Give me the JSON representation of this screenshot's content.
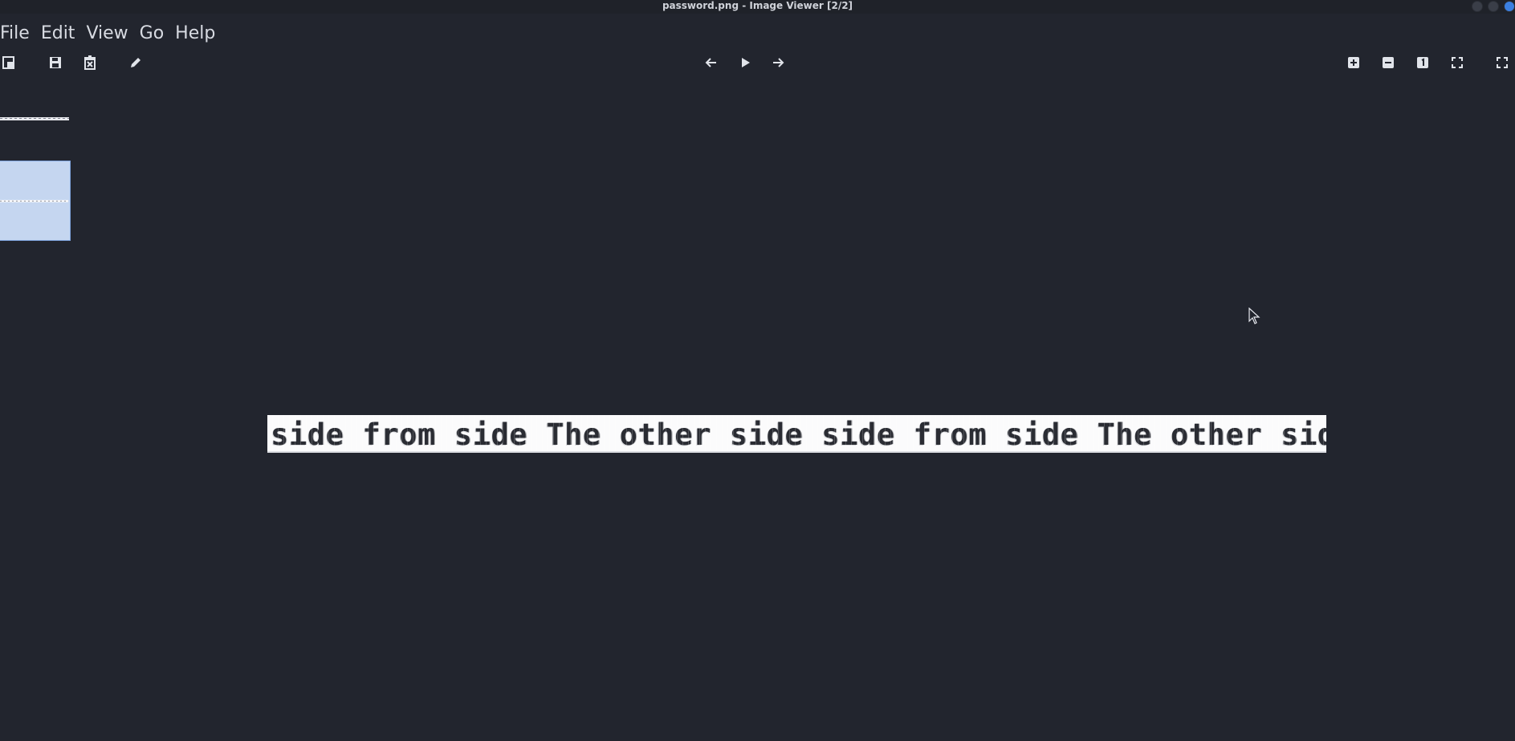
{
  "window": {
    "title": "password.png - Image Viewer [2/2]"
  },
  "menu": {
    "items": [
      {
        "label": "File"
      },
      {
        "label": "Edit"
      },
      {
        "label": "View"
      },
      {
        "label": "Go"
      },
      {
        "label": "Help"
      }
    ]
  },
  "toolbar": {
    "left": [
      {
        "icon": "open-file-icon"
      },
      {
        "icon": "save-icon"
      },
      {
        "icon": "delete-icon"
      },
      {
        "icon": "edit-pencil-icon"
      }
    ],
    "center": [
      {
        "icon": "arrow-left-icon"
      },
      {
        "icon": "play-icon"
      },
      {
        "icon": "arrow-right-icon"
      }
    ],
    "right": [
      {
        "icon": "zoom-in-icon"
      },
      {
        "icon": "zoom-out-icon"
      },
      {
        "icon": "zoom-100-icon"
      },
      {
        "icon": "zoom-fit-icon"
      },
      {
        "icon": "fullscreen-icon"
      }
    ]
  },
  "thumbnails": {
    "count": 2,
    "selected_index": 1
  },
  "image": {
    "filename": "password.png",
    "content_text": "side from side The other side side from side The other side"
  },
  "colors": {
    "background": "#22252e",
    "selection": "#c5d6f0",
    "accent": "#3b7fe0"
  }
}
